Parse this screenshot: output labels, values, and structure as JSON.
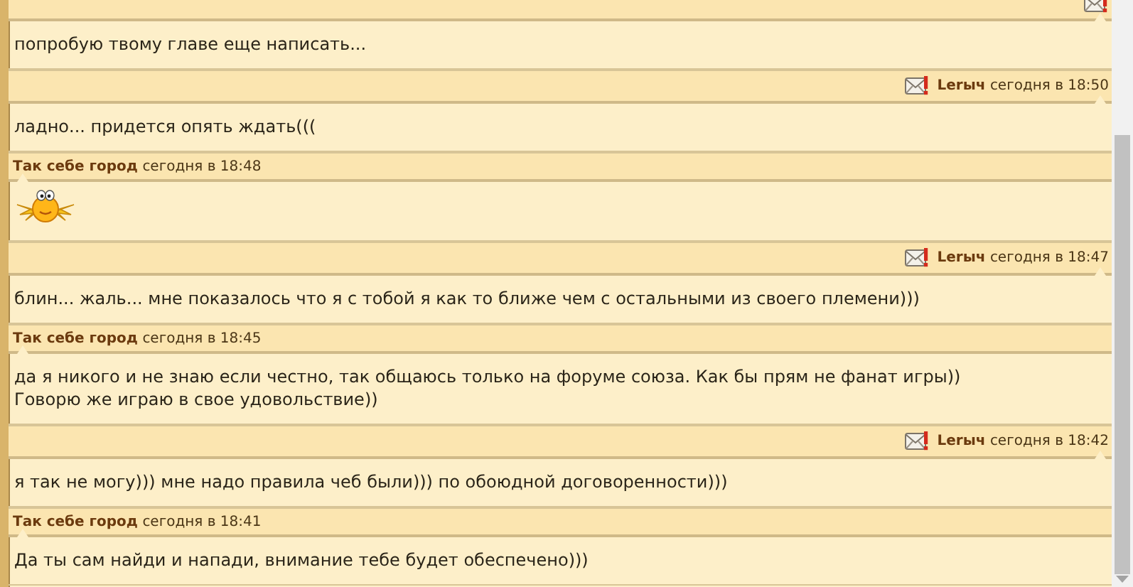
{
  "messages": [
    {
      "kind": "outgoing",
      "body": {
        "kind": "text",
        "text": "попробую твому главе еще написать..."
      }
    },
    {
      "kind": "outgoing",
      "author": "Lerыч",
      "time": "сегодня в 18:50",
      "body": {
        "kind": "text",
        "text": "ладно... придется опять ждать((("
      }
    },
    {
      "kind": "incoming",
      "author": "Так себе город",
      "time": "сегодня в 18:48",
      "body": {
        "kind": "smiley"
      }
    },
    {
      "kind": "outgoing",
      "author": "Lerыч",
      "time": "сегодня в 18:47",
      "body": {
        "kind": "text",
        "text": "блин... жаль... мне показалось что я с тобой я как то ближе чем с остальными из своего племени)))"
      }
    },
    {
      "kind": "incoming",
      "author": "Так себе город",
      "time": "сегодня в 18:45",
      "body": {
        "kind": "text",
        "text": "да я никого и не знаю если честно, так общаюсь только на форуме союза. Как бы прям не фанат игры))\nГоворю же играю в свое удовольствие))"
      }
    },
    {
      "kind": "outgoing",
      "author": "Lerыч",
      "time": "сегодня в 18:42",
      "body": {
        "kind": "text",
        "text": "я так не могу))) мне надо правила чеб были))) по обоюдной договоренности)))"
      }
    },
    {
      "kind": "incoming",
      "author": "Так себе город",
      "time": "сегодня в 18:41",
      "body": {
        "kind": "text",
        "text": "Да ты сам найди и напади, внимание тебе будет обеспечено)))"
      }
    }
  ]
}
